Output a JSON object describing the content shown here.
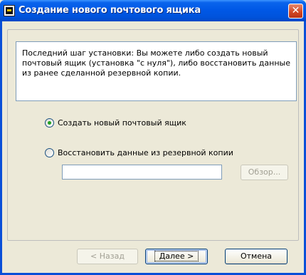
{
  "window": {
    "title": "Создание нового почтового ящика"
  },
  "info_text": "Последний шаг установки: Вы можете либо создать новый почтовый ящик (установка \"с нуля\"), либо восстановить данные из ранее сделанной резервной копии.",
  "options": [
    {
      "label": "Создать новый почтовый ящик",
      "selected": true
    },
    {
      "label": "Восстановить данные из резервной копии",
      "selected": false
    }
  ],
  "backup_path": {
    "value": "",
    "placeholder": ""
  },
  "buttons": {
    "browse": "Обзор...",
    "back": "< Назад",
    "next": "Далее >",
    "cancel": "Отмена"
  }
}
